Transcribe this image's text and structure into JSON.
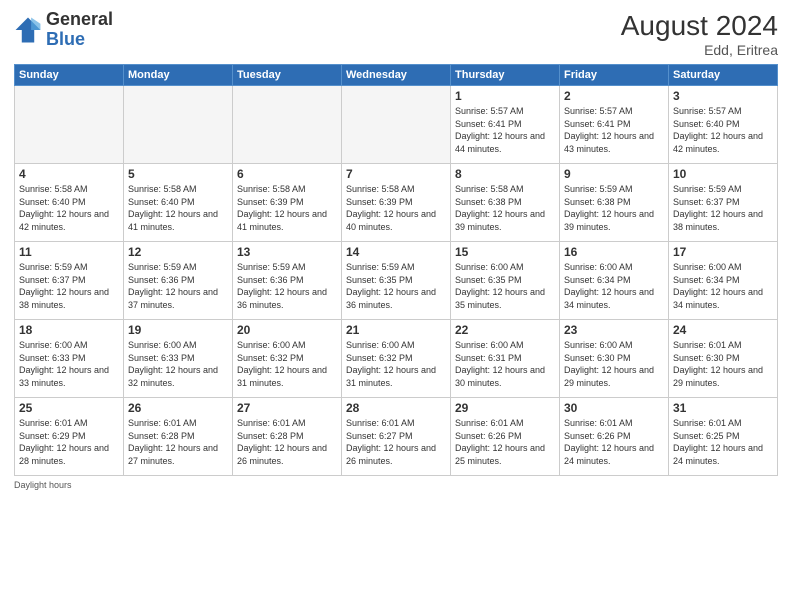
{
  "header": {
    "logo_general": "General",
    "logo_blue": "Blue",
    "month_year": "August 2024",
    "location": "Edd, Eritrea"
  },
  "weekdays": [
    "Sunday",
    "Monday",
    "Tuesday",
    "Wednesday",
    "Thursday",
    "Friday",
    "Saturday"
  ],
  "weeks": [
    [
      {
        "day": "",
        "info": ""
      },
      {
        "day": "",
        "info": ""
      },
      {
        "day": "",
        "info": ""
      },
      {
        "day": "",
        "info": ""
      },
      {
        "day": "1",
        "info": "Sunrise: 5:57 AM\nSunset: 6:41 PM\nDaylight: 12 hours and 44 minutes."
      },
      {
        "day": "2",
        "info": "Sunrise: 5:57 AM\nSunset: 6:41 PM\nDaylight: 12 hours and 43 minutes."
      },
      {
        "day": "3",
        "info": "Sunrise: 5:57 AM\nSunset: 6:40 PM\nDaylight: 12 hours and 42 minutes."
      }
    ],
    [
      {
        "day": "4",
        "info": "Sunrise: 5:58 AM\nSunset: 6:40 PM\nDaylight: 12 hours and 42 minutes."
      },
      {
        "day": "5",
        "info": "Sunrise: 5:58 AM\nSunset: 6:40 PM\nDaylight: 12 hours and 41 minutes."
      },
      {
        "day": "6",
        "info": "Sunrise: 5:58 AM\nSunset: 6:39 PM\nDaylight: 12 hours and 41 minutes."
      },
      {
        "day": "7",
        "info": "Sunrise: 5:58 AM\nSunset: 6:39 PM\nDaylight: 12 hours and 40 minutes."
      },
      {
        "day": "8",
        "info": "Sunrise: 5:58 AM\nSunset: 6:38 PM\nDaylight: 12 hours and 39 minutes."
      },
      {
        "day": "9",
        "info": "Sunrise: 5:59 AM\nSunset: 6:38 PM\nDaylight: 12 hours and 39 minutes."
      },
      {
        "day": "10",
        "info": "Sunrise: 5:59 AM\nSunset: 6:37 PM\nDaylight: 12 hours and 38 minutes."
      }
    ],
    [
      {
        "day": "11",
        "info": "Sunrise: 5:59 AM\nSunset: 6:37 PM\nDaylight: 12 hours and 38 minutes."
      },
      {
        "day": "12",
        "info": "Sunrise: 5:59 AM\nSunset: 6:36 PM\nDaylight: 12 hours and 37 minutes."
      },
      {
        "day": "13",
        "info": "Sunrise: 5:59 AM\nSunset: 6:36 PM\nDaylight: 12 hours and 36 minutes."
      },
      {
        "day": "14",
        "info": "Sunrise: 5:59 AM\nSunset: 6:35 PM\nDaylight: 12 hours and 36 minutes."
      },
      {
        "day": "15",
        "info": "Sunrise: 6:00 AM\nSunset: 6:35 PM\nDaylight: 12 hours and 35 minutes."
      },
      {
        "day": "16",
        "info": "Sunrise: 6:00 AM\nSunset: 6:34 PM\nDaylight: 12 hours and 34 minutes."
      },
      {
        "day": "17",
        "info": "Sunrise: 6:00 AM\nSunset: 6:34 PM\nDaylight: 12 hours and 34 minutes."
      }
    ],
    [
      {
        "day": "18",
        "info": "Sunrise: 6:00 AM\nSunset: 6:33 PM\nDaylight: 12 hours and 33 minutes."
      },
      {
        "day": "19",
        "info": "Sunrise: 6:00 AM\nSunset: 6:33 PM\nDaylight: 12 hours and 32 minutes."
      },
      {
        "day": "20",
        "info": "Sunrise: 6:00 AM\nSunset: 6:32 PM\nDaylight: 12 hours and 31 minutes."
      },
      {
        "day": "21",
        "info": "Sunrise: 6:00 AM\nSunset: 6:32 PM\nDaylight: 12 hours and 31 minutes."
      },
      {
        "day": "22",
        "info": "Sunrise: 6:00 AM\nSunset: 6:31 PM\nDaylight: 12 hours and 30 minutes."
      },
      {
        "day": "23",
        "info": "Sunrise: 6:00 AM\nSunset: 6:30 PM\nDaylight: 12 hours and 29 minutes."
      },
      {
        "day": "24",
        "info": "Sunrise: 6:01 AM\nSunset: 6:30 PM\nDaylight: 12 hours and 29 minutes."
      }
    ],
    [
      {
        "day": "25",
        "info": "Sunrise: 6:01 AM\nSunset: 6:29 PM\nDaylight: 12 hours and 28 minutes."
      },
      {
        "day": "26",
        "info": "Sunrise: 6:01 AM\nSunset: 6:28 PM\nDaylight: 12 hours and 27 minutes."
      },
      {
        "day": "27",
        "info": "Sunrise: 6:01 AM\nSunset: 6:28 PM\nDaylight: 12 hours and 26 minutes."
      },
      {
        "day": "28",
        "info": "Sunrise: 6:01 AM\nSunset: 6:27 PM\nDaylight: 12 hours and 26 minutes."
      },
      {
        "day": "29",
        "info": "Sunrise: 6:01 AM\nSunset: 6:26 PM\nDaylight: 12 hours and 25 minutes."
      },
      {
        "day": "30",
        "info": "Sunrise: 6:01 AM\nSunset: 6:26 PM\nDaylight: 12 hours and 24 minutes."
      },
      {
        "day": "31",
        "info": "Sunrise: 6:01 AM\nSunset: 6:25 PM\nDaylight: 12 hours and 24 minutes."
      }
    ]
  ],
  "footer": "Daylight hours"
}
